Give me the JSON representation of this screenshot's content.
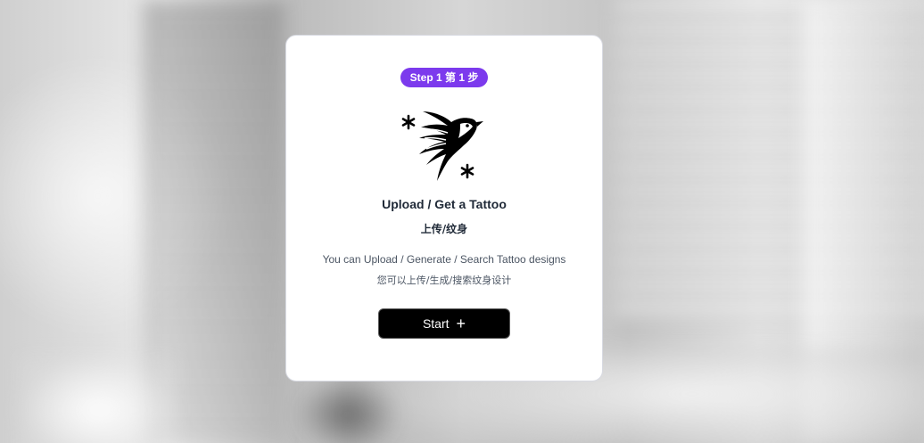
{
  "card": {
    "step_badge": "Step 1 第 1 步",
    "logo_icon": "swallow-tattoo-icon",
    "title_en": "Upload / Get a Tattoo",
    "title_zh": "上传/纹身",
    "description_en": "You can Upload / Generate / Search Tattoo designs",
    "description_zh": "您可以上传/生成/搜索纹身设计",
    "start_button": {
      "label": "Start",
      "icon": "plus-icon",
      "icon_glyph": "+"
    }
  },
  "colors": {
    "badge": "#7c3aed",
    "button": "#000000",
    "card": "#ffffff"
  }
}
